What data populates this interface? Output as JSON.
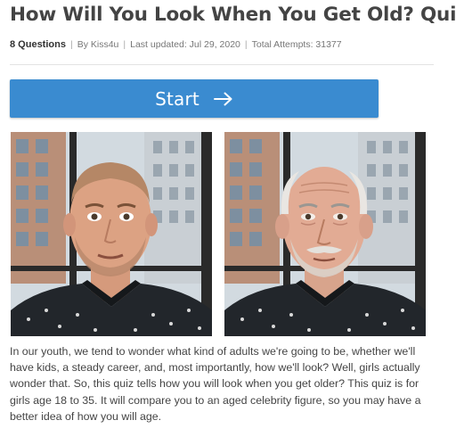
{
  "quiz": {
    "title": "How Will You Look When You Get Old? Quiz!",
    "question_count": "8 Questions",
    "author": "By Kiss4u",
    "last_updated": "Last updated: Jul 29, 2020",
    "total_attempts": "Total Attempts: 31377",
    "start_label": "Start",
    "description": "In our youth, we tend to wonder what kind of adults we're going to be, whether we'll have kids, a steady career, and, most importantly, how we'll look? Well, girls actually wonder that. So, this quiz tells how you will look when you get older? This quiz is for girls age 18 to 35. It will compare you to an aged celebrity figure, so you may have a better idea of how you will age."
  },
  "colors": {
    "accent": "#3a8bd0",
    "title_text": "#444444",
    "meta_text": "#777777"
  },
  "icons": {
    "start_arrow": "arrow-right-icon"
  }
}
